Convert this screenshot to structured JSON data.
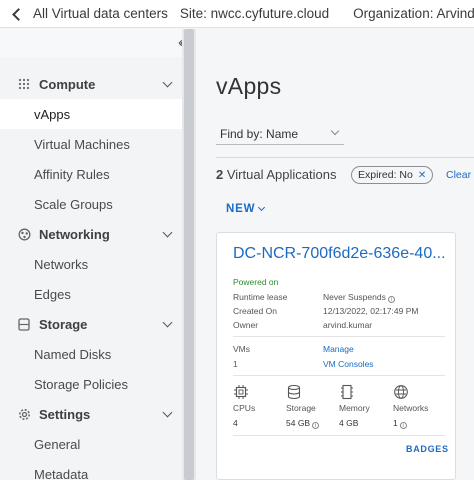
{
  "topbar": {
    "back_label": "All Virtual data centers",
    "site": "Site: nwcc.cyfuture.cloud",
    "organization": "Organization: ArvindK"
  },
  "sidebar": {
    "collapse_icon": "double-chevron-left",
    "groups": [
      {
        "label": "Compute",
        "icon": "compute-grid-icon",
        "items": [
          "vApps",
          "Virtual Machines",
          "Affinity Rules",
          "Scale Groups"
        ]
      },
      {
        "label": "Networking",
        "icon": "networking-icon",
        "items": [
          "Networks",
          "Edges"
        ]
      },
      {
        "label": "Storage",
        "icon": "storage-icon",
        "items": [
          "Named Disks",
          "Storage Policies"
        ]
      },
      {
        "label": "Settings",
        "icon": "gear-icon",
        "items": [
          "General",
          "Metadata"
        ]
      }
    ],
    "active_item": "vApps"
  },
  "main": {
    "title": "vApps",
    "find_by_label": "Find by:",
    "find_by_value": "Name",
    "count": "2",
    "count_label": "Virtual Applications",
    "filter_chip": "Expired: No",
    "clear_label": "Clear",
    "new_label": "NEW"
  },
  "card": {
    "title": "DC-NCR-700f6d2e-636e-40...",
    "status": "Powered on",
    "runtime_lease_label": "Runtime lease",
    "runtime_lease_value": "Never Suspends",
    "created_on_label": "Created On",
    "created_on_value": "12/13/2022, 02:17:49 PM",
    "owner_label": "Owner",
    "owner_value": "arvind.kumar",
    "vms_label": "VMs",
    "vms_value": "1",
    "manage_label": "Manage",
    "vm_consoles_label": "VM Consoles",
    "resources": [
      {
        "label": "CPUs",
        "value": "4",
        "icon": "cpu-icon"
      },
      {
        "label": "Storage",
        "value": "54 GB",
        "icon": "database-icon"
      },
      {
        "label": "Memory",
        "value": "4 GB",
        "icon": "memory-icon"
      },
      {
        "label": "Networks",
        "value": "1",
        "icon": "globe-icon"
      }
    ],
    "badges_label": "BADGES"
  },
  "colors": {
    "accent": "#1b6bc2",
    "status_green": "#2e8b2e"
  }
}
